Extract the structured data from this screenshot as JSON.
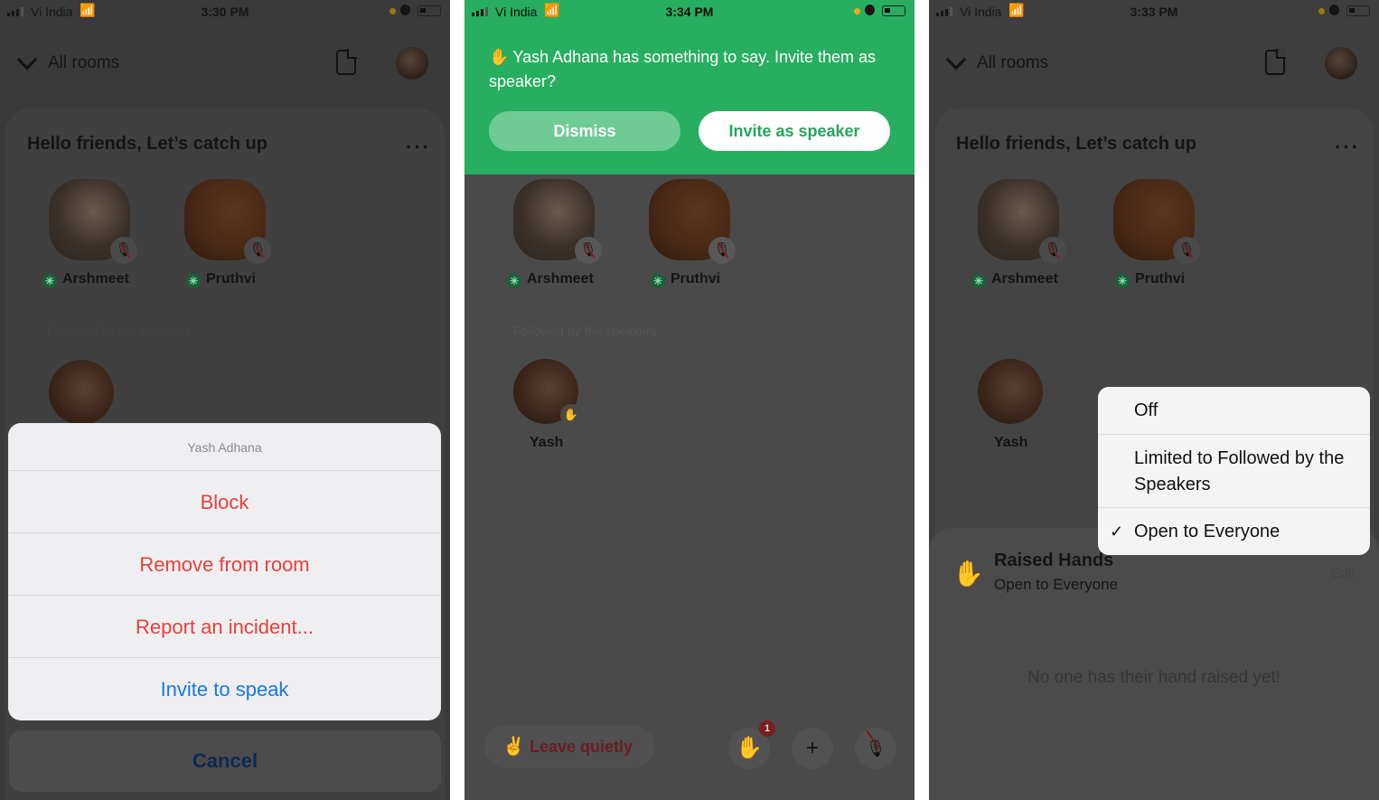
{
  "panels": [
    {
      "status": {
        "carrier": "Vi India",
        "time": "3:30 PM"
      },
      "header": {
        "back_label": "All rooms"
      },
      "room": {
        "title": "Hello friends, Let’s catch up",
        "speakers": [
          {
            "name": "Arshmeet",
            "muted": true,
            "moderator": true
          },
          {
            "name": "Pruthvi",
            "muted": true,
            "moderator": true
          }
        ],
        "followed_label": "Followed by the speakers"
      },
      "action_sheet": {
        "title": "Yash Adhana",
        "items": [
          {
            "label": "Block",
            "style": "destructive"
          },
          {
            "label": "Remove from room",
            "style": "destructive"
          },
          {
            "label": "Report an incident...",
            "style": "destructive"
          },
          {
            "label": "Invite to speak",
            "style": "default"
          }
        ],
        "cancel_label": "Cancel"
      }
    },
    {
      "status": {
        "carrier": "Vi India",
        "time": "3:34 PM"
      },
      "banner": {
        "message": "Yash Adhana has something to say. Invite them as speaker?",
        "dismiss_label": "Dismiss",
        "invite_label": "Invite as speaker"
      },
      "room": {
        "speakers": [
          {
            "name": "Arshmeet",
            "muted": true,
            "moderator": true
          },
          {
            "name": "Pruthvi",
            "muted": true,
            "moderator": true
          }
        ],
        "followed_label": "Followed by the speakers",
        "listeners": [
          {
            "name": "Yash",
            "hand_raised": true
          }
        ]
      },
      "bottom_bar": {
        "leave_label": "Leave quietly",
        "raised_hands_count": "1",
        "add_label": "+"
      }
    },
    {
      "status": {
        "carrier": "Vi India",
        "time": "3:33 PM"
      },
      "header": {
        "back_label": "All rooms"
      },
      "room": {
        "title": "Hello friends, Let’s catch up",
        "speakers": [
          {
            "name": "Arshmeet",
            "muted": true,
            "moderator": true
          },
          {
            "name": "Pruthvi",
            "muted": true,
            "moderator": true
          }
        ],
        "followed_label": "Followed by the speakers",
        "listeners": [
          {
            "name": "Yash"
          }
        ]
      },
      "raised_hands": {
        "title": "Raised Hands",
        "setting": "Open to Everyone",
        "edit_label": "Edit",
        "empty_message": "No one has their hand raised yet!"
      },
      "menu": {
        "options": [
          {
            "label": "Off",
            "selected": false
          },
          {
            "label": "Limited to Followed by the Speakers",
            "selected": false
          },
          {
            "label": "Open to Everyone",
            "selected": true
          }
        ],
        "check_glyph": "✓"
      }
    }
  ],
  "colors": {
    "clubhouse_green": "#28ae60",
    "destructive_red": "#e8403a",
    "ios_blue": "#1877e6"
  }
}
